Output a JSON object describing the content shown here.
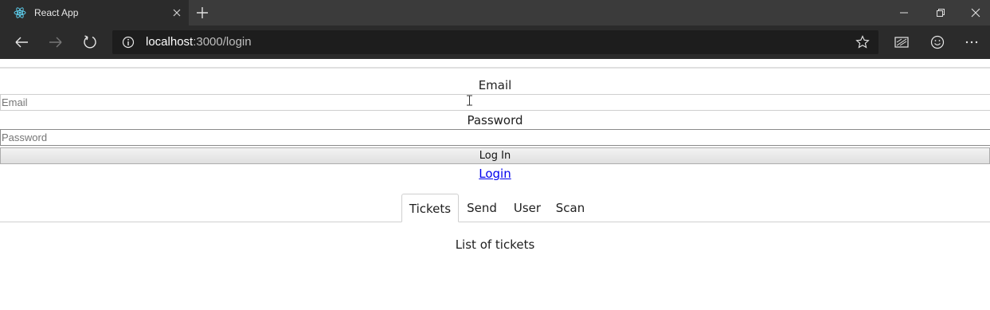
{
  "browser": {
    "tab_title": "React App",
    "url_host": "localhost",
    "url_rest": ":3000/login",
    "icons": [
      "react-favicon-icon",
      "close-icon",
      "plus-icon",
      "minimize-icon",
      "restore-icon",
      "close-window-icon",
      "back-arrow-icon",
      "forward-arrow-icon",
      "refresh-icon",
      "info-icon",
      "star-icon",
      "reading-view-icon",
      "smiley-icon",
      "more-icon"
    ],
    "colors": {
      "chrome_dark": "#2b2b2b",
      "chrome_tabbar": "#3b3b3b",
      "omnibox": "#1d1d1d",
      "react_blue": "#61dafb"
    }
  },
  "form": {
    "email_label": "Email",
    "email_placeholder": "Email",
    "email_value": "",
    "password_label": "Password",
    "password_placeholder": "Password",
    "password_value": "",
    "submit_label": "Log In",
    "login_link": "Login"
  },
  "nav": {
    "tabs": [
      {
        "label": "Tickets",
        "active": true
      },
      {
        "label": "Send",
        "active": false
      },
      {
        "label": "User",
        "active": false
      },
      {
        "label": "Scan",
        "active": false
      }
    ]
  },
  "panel": {
    "text": "List of tickets"
  }
}
